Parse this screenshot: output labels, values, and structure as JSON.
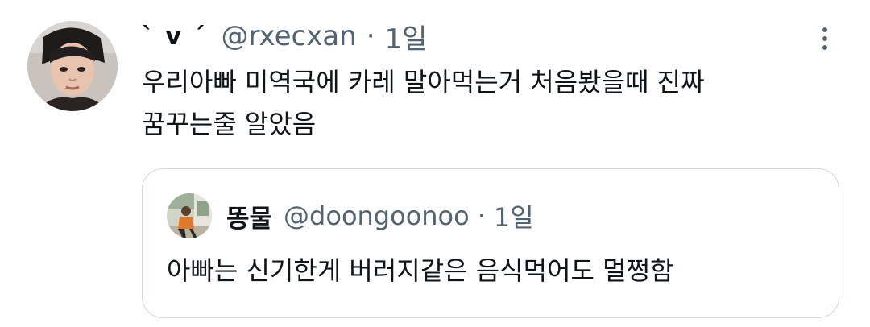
{
  "tweet": {
    "display_name": "` v ´",
    "handle": "@rxecxan",
    "separator": "·",
    "time": "1일",
    "text_line_1": "우리아빠 미역국에 카레 말아먹는거 처음봤을때 진짜",
    "text_line_2": "꿈꾸는줄 알았음"
  },
  "quoted_tweet": {
    "display_name": "똥물",
    "handle": "@doongoonoo",
    "separator": "·",
    "time": "1일",
    "text": "아빠는 신기한게 버러지같은 음식먹어도 멀쩡함"
  },
  "icons": {
    "more": "more-vertical-icon"
  },
  "colors": {
    "text_primary": "#0f1419",
    "text_secondary": "#536471",
    "border": "#cfd9de"
  }
}
